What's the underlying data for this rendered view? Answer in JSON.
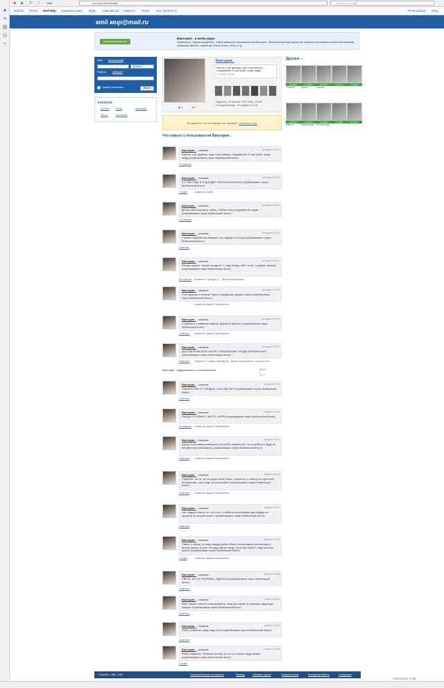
{
  "browser": {
    "url": "my.mail.ru/bk/vikapo/",
    "search_placeholder": "Искать в Google",
    "tab_label": "Ввб"
  },
  "nav": {
    "items": [
      "Mail.Ru",
      "Почта",
      "Мой Мир",
      "Одноклассники",
      "Игры",
      "Знакомства",
      "Новости",
      "Поиск",
      "Все проекты ▾"
    ],
    "right": [
      "Регистрация",
      "Вход"
    ]
  },
  "banner": {
    "logo": "мой мир@mail.ru"
  },
  "promo": {
    "button": "Зарегистрироваться",
    "title": "Виктория . в моём мире",
    "text": "Пожалуйста, зарегистрируйтесь, чтобы связаться с пользователем Виктория . Заполнив короткую форму вы сможете пользоваться всеми бесплатными сервисами Mail.Ru, такими как Почта, Блоги, Фото, и т.д."
  },
  "login": {
    "name_label": "Имя",
    "register_link": "регистрация",
    "domain": "@mail.ru",
    "password_label": "Пароль",
    "forgot_link": "забыли?",
    "remember": "Чужой компьютер",
    "submit": "Войти"
  },
  "catalog": {
    "title": "Каталоги",
    "items": [
      "Центры",
      "ВУЗы",
      "Колледжи",
      "Места",
      "Компании"
    ]
  },
  "profile": {
    "name": "Виктория .",
    "status": "Короче, я во францы. Щас тоеу заберут следователи. И хуй знает, когда зайду",
    "status_time": "20 минут назад",
    "birth": "Родилась: 16 августа 1997 (Лев), 15 лет",
    "last_visit": "Последний визит: 20 ноября в 12:34",
    "counters": [
      "3",
      "0"
    ]
  },
  "human_check": {
    "text": "Не уверены, что это именно тот человек?",
    "link": "Уточнить у нее"
  },
  "feed": {
    "heading": "Что нового у пользователя Виктория .",
    "posts": [
      {
        "who": "Виктория .",
        "action": "сказала:",
        "time": "сегодня в 10:20",
        "text": "Короче, я во франсы. Щас тоеу заберут следователи. И хуй знает, когда зайду (опубликовано через Мобильный Агент)",
        "comments": "11 ответов",
        "likes": ""
      },
      {
        "who": "Виктория .",
        "action": "сказала:",
        "time": "сегодня в 00:25",
        "text": "А У НАС ЕЩЕ И СУД БУДЕТ АХАХАХАХАХАХАХ (опубликовано через Мобильный Агент)",
        "comments": "1 ответ",
        "likes": "Нравится: Кайф"
      },
      {
        "who": "Виктория .",
        "action": "сказала:",
        "time": "сегодня в 00:16",
        "text": "До сих пор в мусарне, капец. Сейчас тоеу следователю отдаю (опубликовано через Мобильный Агент)",
        "comments": "13 ответов",
        "likes": ""
      },
      {
        "who": "Виктория .",
        "action": "сказала:",
        "time": "сегодня в 00:14",
        "text": "У меня следователь забирает тоу, отдадут со когда (опубликовано через Мобильный Агент)",
        "comments": "Ответить",
        "likes": ""
      },
      {
        "who": "Виктория .",
        "action": "сказала:",
        "time": "сегодня в 23:01",
        "text": "Малыш кричит \"лучше посадите\" я \"щас втащу тебе\" опер: \"у, давай, малыш\" (опубликовано через Мобильный Агент)",
        "comments": "30 ответов",
        "likes": "Нравится: \"Зануда :D\" , Диана Нарыбулина"
      },
      {
        "who": "Виктория .",
        "action": "сказала:",
        "time": "сегодня в 10:00",
        "text": "Я во францы с опером. Едем с преданым, рядом с нами (опубликовано через Мобильный Агент)",
        "comments": "",
        "likes": "Нравится: Диана Нарыбулина"
      },
      {
        "who": "Виктория .",
        "action": "сказала:",
        "time": "сегодня в 03:22",
        "text": "Сьебалась с кабинета завуча. Домой не вернусь (опубликовано через Мобильный Агент)",
        "comments": "Ответить",
        "likes": "Нравится: Диана Нарыбулина"
      },
      {
        "who": "Виктория .",
        "action": "сказала:",
        "time": "сегодня в 00:37",
        "text": "ДА ПОШЛИ ВЫ ВСЕ НАХУЙ, СУКИ ЕБАНЫЕ УРОДЫ МОРАЛЬНЫЕ!! (опубликовано через Мобильный Агент)",
        "comments": "Ответить",
        "likes": "Нравится: Славик Пивоваров , Диана Нарыбулина , Анжела Кош"
      },
      {
        "who": "Виктория .",
        "action": "сказала:",
        "time": "вчера в 10:46",
        "text": "ТАБЛЕТОЧКИ ОТ СЕРДЦА СУКА ГДЕ ВЫ?! (опубликовано через Мобильный Агент)",
        "comments": "Ответить",
        "likes": ""
      },
      {
        "who": "Виктория .",
        "action": "сказала:",
        "time": "вчера в 14:08",
        "text": "ПИЦЦИ УГРОЖАЕТ ЧИСТО, НОРМ (опубликовано через Мобильный Агент)",
        "comments": "10 ответов",
        "likes": "Нравится: Диана Нарыбулина"
      },
      {
        "who": "Виктория .",
        "action": "сказала:",
        "time": "вчера в 14:27",
        "text": "народ, если завтра начнуться в 5 в бой, скажите же, что в субботу я буду за пятнами проскальзывать (опубликовано через Мобильный Агент)",
        "comments": "Ответить",
        "likes": "Нравится: Диана Нарыбулина"
      },
      {
        "who": "Виктория .",
        "action": "сказала:",
        "time": "вчера в 16:16",
        "text": "Савченко, ты че, ты не вкурсе всей темы, я звонила, я отвечу за тоуей! всё Белозерова, тоже сиди на жопе ровно! (опубликовано через Мобильный Агент)",
        "comments": "Ответить",
        "likes": "Нравится: Диана Нарыбулина"
      },
      {
        "who": "Виктория .",
        "action": "сказала:",
        "time": "вчера в 14:57",
        "text": "так, подруги Насти, кто тот есть, в субботу встречаемся где-нибудь и я проясню за тролей эгоист? (опубликовано через Мобильный Агент)",
        "comments": "Ответить",
        "likes": ""
      },
      {
        "who": "Виктория .",
        "action": "сказала:",
        "time": "вчера в 14:03",
        "text": "Света, я прошу, не надо никуда делать блять на выходных им маннику я прошу! вышло ж уже. не сиди завтра нигде, если вас ногой?! сиди на жопе ровно! (опубликовано через Мобильный Агент)",
        "comments": "1 ответ",
        "likes": "Нравится: Диана Нарыбулина"
      },
      {
        "who": "Виктория .",
        "action": "сказала:",
        "time": "вчера в 13:58",
        "text": "СВЕТА, ЧО ТЫ ТВОРИШЬ, ИДИОТКА (опубликовано через Мобильный Агент)",
        "comments": "Ответить",
        "likes": ""
      },
      {
        "who": "Виктория .",
        "action": "сказала:",
        "time": "вчера в 13:46",
        "text": "блин, мама с папой снова ругаются, папа про какой-то переезд с квартиры говорит. (опубликовано через Мобильный Агент)",
        "comments": "Ответить",
        "likes": ""
      },
      {
        "who": "Виктория .",
        "action": "сказала:",
        "time": "вчера в 13:32",
        "text": "Ребят, новый ак, кому надо, в лс (опубликовано через Мобильный Агент)",
        "comments": "Ответить",
        "likes": ""
      },
      {
        "who": "Виктория .",
        "action": "сказала:",
        "time": "вчера в 12:48",
        "text": "Ребят, новый ак. Заебали потому что на тот писать люди всякие (опубликовано через Мобильный Агент)",
        "comments": "1 ответ",
        "likes": ""
      }
    ],
    "join": {
      "text": "Виктория . подружилась с пользователем",
      "time": "вчера в 10:17"
    }
  },
  "friends": {
    "title": "Друзья",
    "count": "69",
    "online_label": "на сайте",
    "names": [
      "**Ирина**",
      "Ирина",
      "Мартин",
      "",
      "",
      "",
      "Маня Ю",
      "Никифорова",
      "am Виктория",
      "",
      "",
      ""
    ]
  },
  "footer": {
    "copyright": "© Mail.Ru, 1998—2012",
    "links": [
      "Пользовательское соглашение",
      "Помощь",
      "Обновить проект",
      "Разработчикам",
      "Реклама на Mail.Ru",
      "О компании"
    ]
  },
  "watermark": "YAPLAKAL.COM"
}
